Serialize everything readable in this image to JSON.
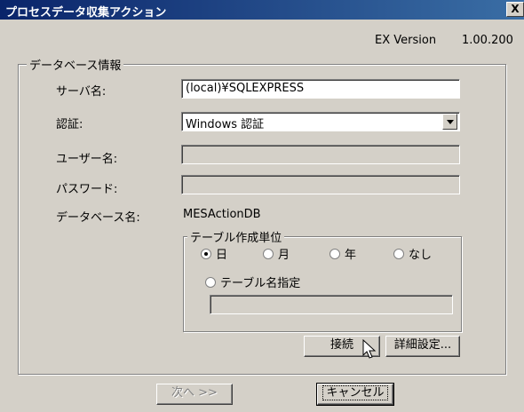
{
  "window": {
    "title": "プロセスデータ収集アクション",
    "close_label": "X"
  },
  "version": {
    "edition": "EX Version",
    "number": "1.00.200"
  },
  "db_group": {
    "title": "データベース情報"
  },
  "fields": {
    "server_label": "サーバ名:",
    "server_value": "(local)¥SQLEXPRESS",
    "auth_label": "認証:",
    "auth_value": "Windows 認証",
    "user_label": "ユーザー名:",
    "password_label": "パスワード:",
    "dbname_label": "データベース名:",
    "dbname_value": "MESActionDB"
  },
  "table_group": {
    "title": "テーブル作成単位",
    "options": [
      "日",
      "月",
      "年",
      "なし"
    ],
    "selected": "日",
    "custom_label": "テーブル名指定"
  },
  "buttons": {
    "connect": "接続",
    "advanced": "詳細設定...",
    "next": "次へ >>",
    "cancel": "キャンセル"
  },
  "icons": {
    "cursor": "mouse-pointer-icon",
    "dropdown": "chevron-down-icon"
  }
}
